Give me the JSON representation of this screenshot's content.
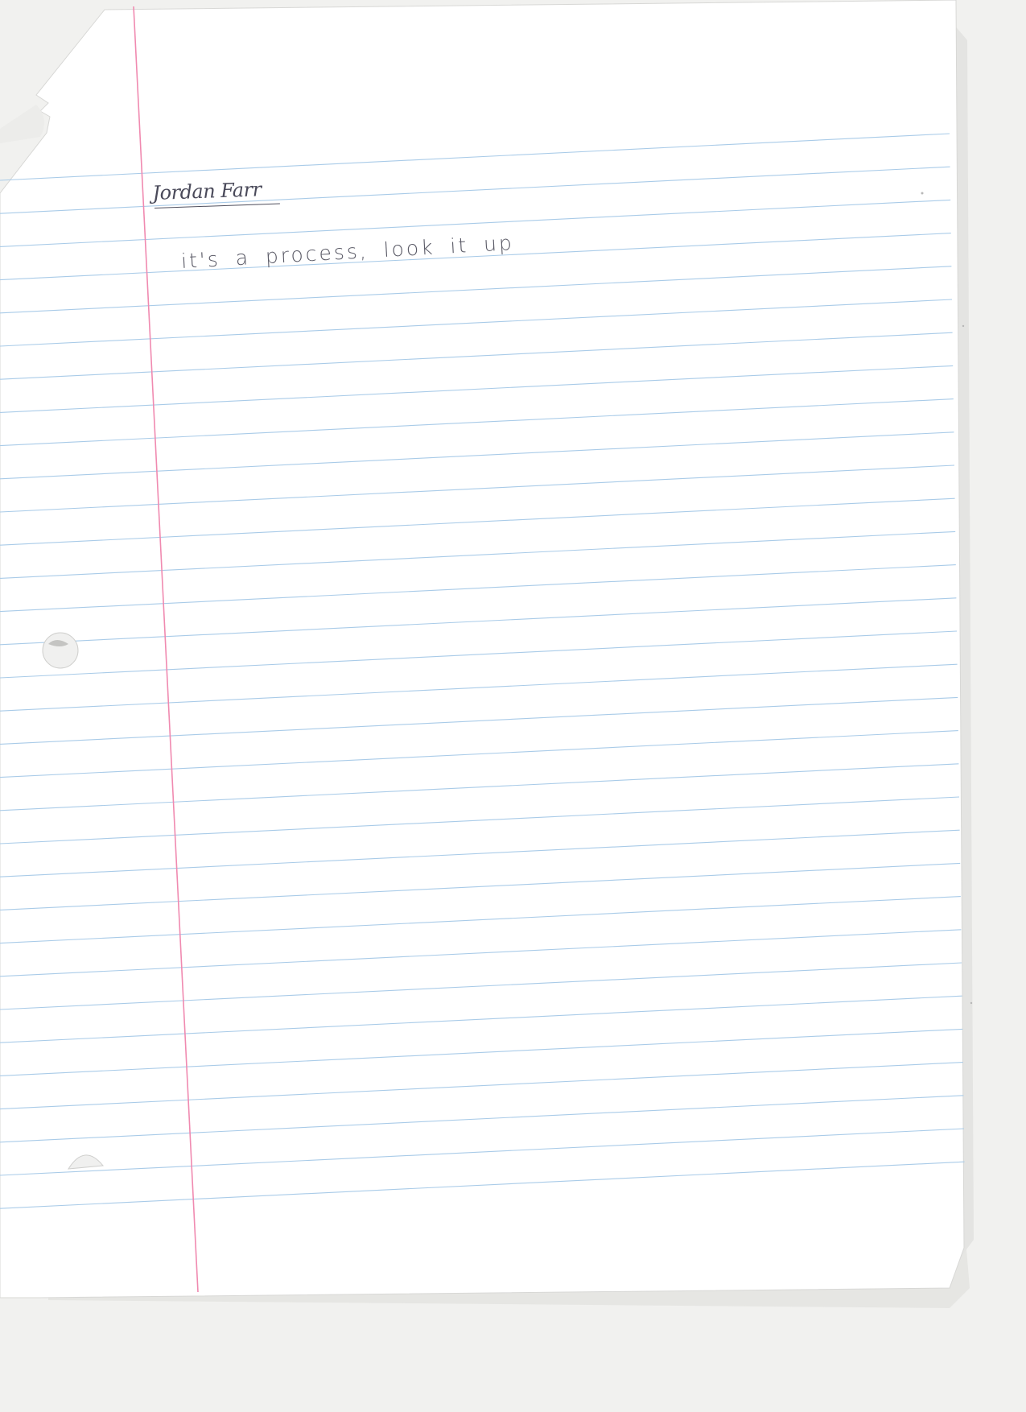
{
  "page": {
    "paper_color": "#ffffff",
    "rule_color": "#a9cbe8",
    "margin_color": "#f08ab0",
    "background_color": "#f1f1ef"
  },
  "note": {
    "title": "Jordan Farr",
    "line": "it's a process, look it up"
  }
}
